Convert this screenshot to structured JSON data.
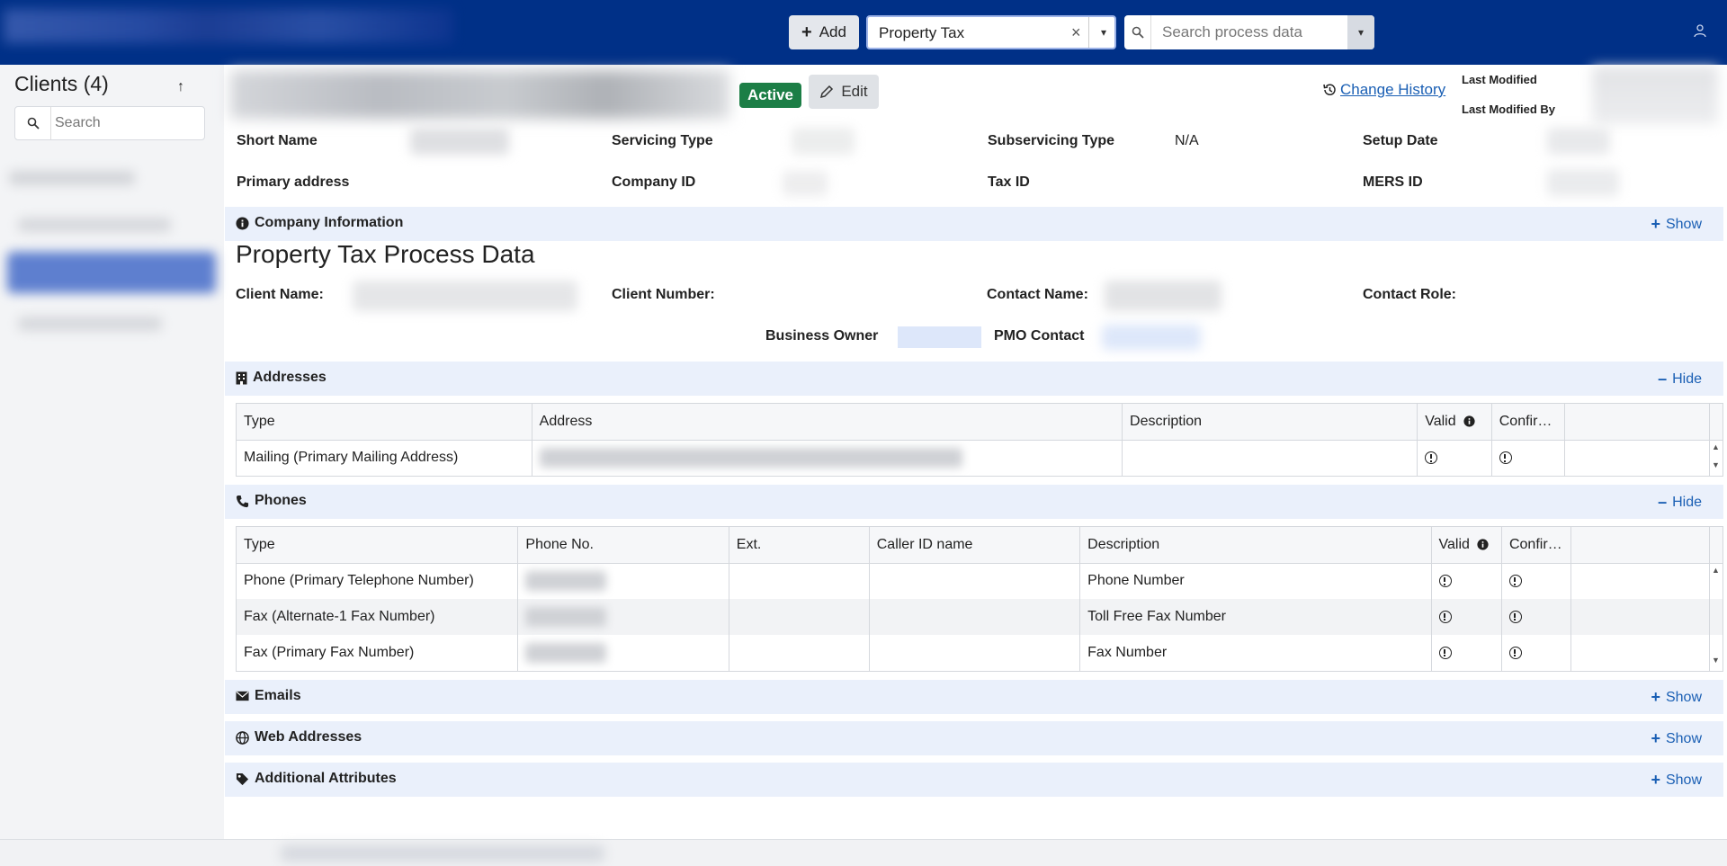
{
  "header": {
    "add_label": "Add",
    "process_value": "Property Tax",
    "clear_symbol": "×",
    "dropdown_symbol": "▾",
    "search_placeholder": "Search process data"
  },
  "sidebar": {
    "title": "Clients (4)",
    "sort_symbol": "↑",
    "search_placeholder": "Search"
  },
  "client": {
    "status": "Active",
    "edit_label": "Edit",
    "change_history_label": "Change History",
    "last_modified_label": "Last Modified",
    "last_modified_by_label": "Last Modified By",
    "fields": {
      "short_name": "Short Name",
      "servicing_type": "Servicing Type",
      "subservicing_type": "Subservicing Type",
      "subservicing_type_value": "N/A",
      "setup_date": "Setup Date",
      "primary_address": "Primary address",
      "company_id": "Company ID",
      "tax_id": "Tax ID",
      "mers_id": "MERS ID"
    }
  },
  "company_info": {
    "label": "Company Information",
    "toggle": "Show"
  },
  "process_data": {
    "title": "Property Tax Process Data",
    "client_name": "Client Name:",
    "client_number": "Client Number:",
    "contact_name": "Contact Name:",
    "contact_role": "Contact Role:",
    "business_owner": "Business Owner",
    "pmo_contact": "PMO Contact"
  },
  "addresses": {
    "label": "Addresses",
    "toggle": "Hide",
    "columns": [
      "Type",
      "Address",
      "Description",
      "Valid",
      "Confir…"
    ],
    "rows": [
      {
        "type": "Mailing (Primary Mailing Address)",
        "description": ""
      }
    ]
  },
  "phones": {
    "label": "Phones",
    "toggle": "Hide",
    "columns": [
      "Type",
      "Phone No.",
      "Ext.",
      "Caller ID name",
      "Description",
      "Valid",
      "Confir…"
    ],
    "rows": [
      {
        "type": "Phone (Primary Telephone Number)",
        "ext": "",
        "caller_id": "",
        "description": "Phone Number"
      },
      {
        "type": "Fax (Alternate-1 Fax Number)",
        "ext": "",
        "caller_id": "",
        "description": "Toll Free Fax Number"
      },
      {
        "type": "Fax (Primary Fax Number)",
        "ext": "",
        "caller_id": "",
        "description": "Fax Number"
      }
    ]
  },
  "emails": {
    "label": "Emails",
    "toggle": "Show"
  },
  "web_addresses": {
    "label": "Web Addresses",
    "toggle": "Show"
  },
  "additional_attributes": {
    "label": "Additional Attributes",
    "toggle": "Show"
  },
  "colors": {
    "topbar": "#003087",
    "active_badge": "#1c7e46",
    "link": "#1a5fb4",
    "section_bar": "#eaf0fb"
  }
}
